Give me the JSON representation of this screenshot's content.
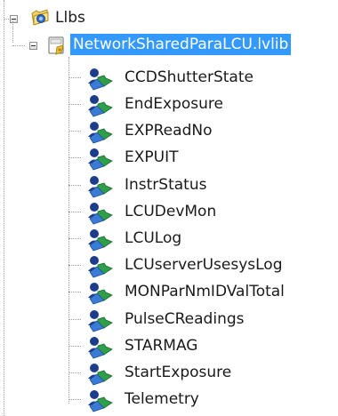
{
  "tree": {
    "folder": {
      "label": "Llbs",
      "icon": "folder-icon"
    },
    "library": {
      "label": "NetworkSharedParaLCU.lvlib",
      "icon": "library-icon",
      "selected": true
    },
    "variables": [
      {
        "label": "CCDShutterState",
        "icon": "shared-variable-icon"
      },
      {
        "label": "EndExposure",
        "icon": "shared-variable-icon"
      },
      {
        "label": "EXPReadNo",
        "icon": "shared-variable-icon"
      },
      {
        "label": "EXPUIT",
        "icon": "shared-variable-icon"
      },
      {
        "label": "InstrStatus",
        "icon": "shared-variable-icon"
      },
      {
        "label": "LCUDevMon",
        "icon": "shared-variable-icon"
      },
      {
        "label": "LCULog",
        "icon": "shared-variable-icon"
      },
      {
        "label": "LCUserverUsesysLog",
        "icon": "shared-variable-icon"
      },
      {
        "label": "MONParNmIDValTotal",
        "icon": "shared-variable-icon"
      },
      {
        "label": "PulseCReadings",
        "icon": "shared-variable-icon"
      },
      {
        "label": "STARMAG",
        "icon": "shared-variable-icon"
      },
      {
        "label": "StartExposure",
        "icon": "shared-variable-icon"
      },
      {
        "label": "Telemetry",
        "icon": "shared-variable-icon"
      }
    ]
  },
  "colors": {
    "selection": "#3399ff",
    "text": "#1a1a1a"
  }
}
